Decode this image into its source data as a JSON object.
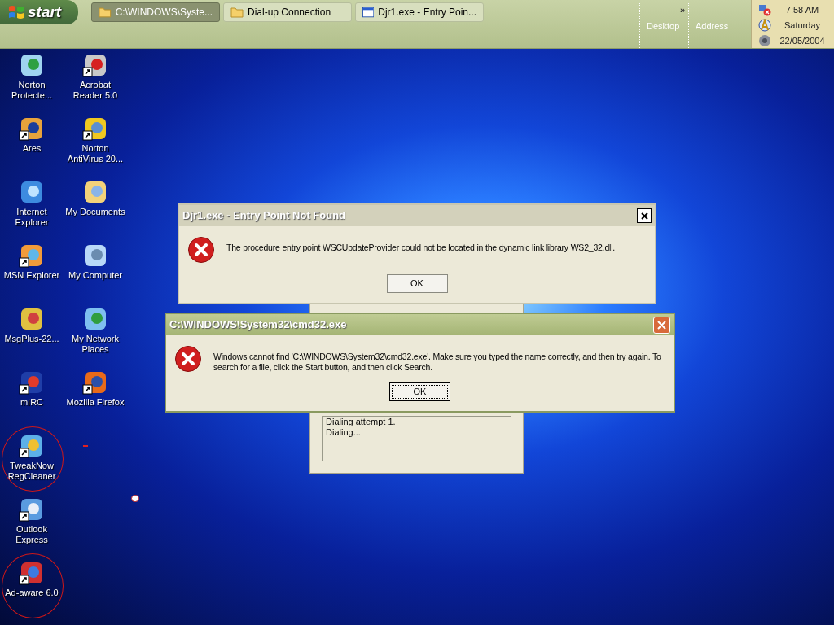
{
  "taskbar": {
    "start_label": "start",
    "tasks": [
      {
        "kind": "folder",
        "label": "C:\\WINDOWS\\Syste...",
        "selected": true
      },
      {
        "kind": "folder",
        "label": "Dial-up Connection",
        "selected": false
      },
      {
        "kind": "window",
        "label": "Djr1.exe - Entry Poin...",
        "selected": false
      }
    ],
    "chevron": "»",
    "toolbars": [
      "Desktop",
      "Address"
    ],
    "clock": {
      "time": "7:58 AM",
      "day": "Saturday",
      "date": "22/05/2004"
    }
  },
  "desktop": {
    "columns": [
      {
        "icons": [
          {
            "label": "Norton Protecte...",
            "shortcut": false
          },
          {
            "label": "Ares",
            "shortcut": true
          },
          {
            "label": "Internet Explorer",
            "shortcut": false
          },
          {
            "label": "MSN Explorer",
            "shortcut": true
          },
          {
            "label": "MsgPlus-22...",
            "shortcut": false
          },
          {
            "label": "mIRC",
            "shortcut": true
          },
          {
            "label": "TweakNow RegCleaner",
            "shortcut": true,
            "circled": true
          },
          {
            "label": "Outlook Express",
            "shortcut": true
          },
          {
            "label": "Ad-aware 6.0",
            "shortcut": true,
            "circled": true
          }
        ]
      },
      {
        "icons": [
          {
            "label": "Acrobat Reader 5.0",
            "shortcut": true
          },
          {
            "label": "Norton AntiVirus 20...",
            "shortcut": true
          },
          {
            "label": "My Documents",
            "shortcut": false
          },
          {
            "label": "My Computer",
            "shortcut": false
          },
          {
            "label": "My Network Places",
            "shortcut": false
          },
          {
            "label": "Mozilla Firefox",
            "shortcut": true
          }
        ]
      }
    ]
  },
  "dialup_window": {
    "lines": [
      "Dialing attempt 1.",
      "Dialing..."
    ]
  },
  "dialogs": [
    {
      "title": "Djr1.exe - Entry Point Not Found",
      "active": false,
      "message": "The procedure entry point WSCUpdateProvider could not be located in the dynamic link library WS2_32.dll.",
      "button": "OK",
      "focused": false
    },
    {
      "title": "C:\\WINDOWS\\System32\\cmd32.exe",
      "active": true,
      "message": "Windows cannot find 'C:\\WINDOWS\\System32\\cmd32.exe'. Make sure you typed the name correctly, and then try again. To search for a file, click the Start button, and then click Search.",
      "button": "OK",
      "focused": true
    }
  ]
}
